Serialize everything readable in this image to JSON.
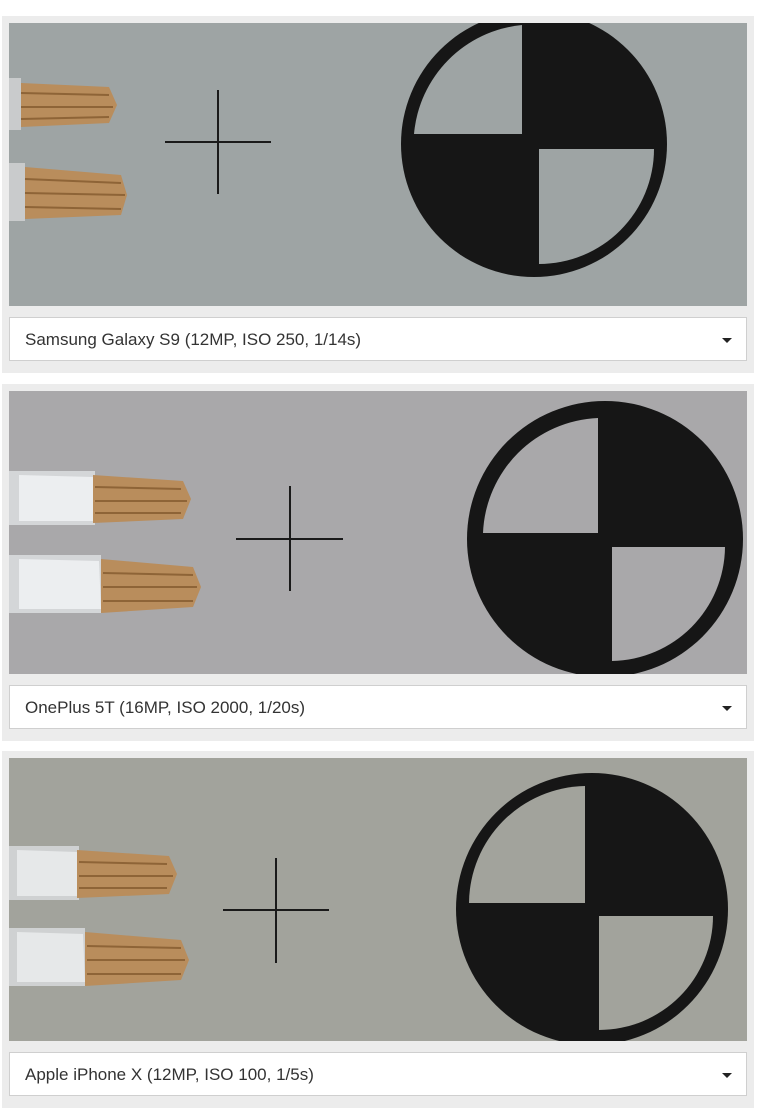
{
  "panels": [
    {
      "camera_label": "Samsung Galaxy S9 (12MP, ISO 250, 1/14s)",
      "background_color": "#9ea4a4",
      "icon": "chevron-down-icon"
    },
    {
      "camera_label": "OnePlus 5T (16MP, ISO 2000, 1/20s)",
      "background_color": "#a9a8aa",
      "icon": "chevron-down-icon"
    },
    {
      "camera_label": "Apple iPhone X (12MP, ISO 100, 1/5s)",
      "background_color": "#a2a39c",
      "icon": "chevron-down-icon"
    }
  ]
}
